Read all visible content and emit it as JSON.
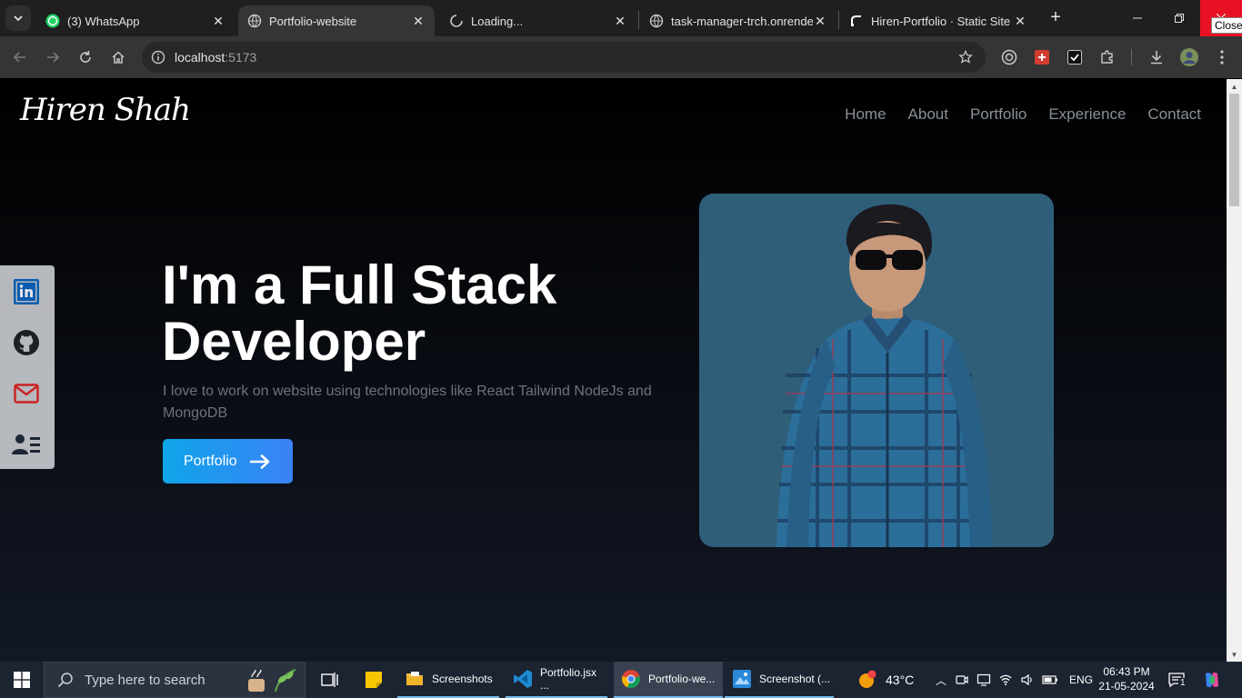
{
  "browser": {
    "tabs": [
      {
        "title": "(3) WhatsApp",
        "icon": "whatsapp-icon",
        "active": false
      },
      {
        "title": "Portfolio-website",
        "icon": "globe-icon",
        "active": true
      },
      {
        "title": "Loading...",
        "icon": "loading-spinner-icon",
        "active": false
      },
      {
        "title": "task-manager-trch.onrender",
        "icon": "globe-icon",
        "active": false
      },
      {
        "title": "Hiren-Portfolio · Static Site",
        "icon": "render-icon",
        "active": false
      }
    ],
    "close_tooltip": "Close",
    "url_host": "localhost",
    "url_port": ":5173"
  },
  "site": {
    "logo": "Hiren Shah",
    "nav": [
      "Home",
      "About",
      "Portfolio",
      "Experience",
      "Contact"
    ],
    "hero_title": "I'm a Full Stack Developer",
    "hero_subtitle": "I love to work on website using technologies like React Tailwind NodeJs and MongoDB",
    "cta_label": "Portfolio",
    "social": [
      "linkedin-icon",
      "github-icon",
      "mail-icon",
      "resume-icon"
    ],
    "photo_bg": "#2f5e79"
  },
  "taskbar": {
    "search_placeholder": "Type here to search",
    "apps": [
      {
        "label": "Screenshots",
        "icon": "folder-icon"
      },
      {
        "label": "Portfolio.jsx ...",
        "icon": "vscode-icon"
      },
      {
        "label": "Portfolio-we...",
        "icon": "chrome-icon"
      },
      {
        "label": "Screenshot (...",
        "icon": "photos-icon"
      }
    ],
    "weather": "43°C",
    "language": "ENG",
    "time": "06:43 PM",
    "date": "21-05-2024",
    "notification_count": "1"
  },
  "colors": {
    "accent_start": "#0ea5e9",
    "accent_end": "#3b82f6",
    "nav_text": "#8a8f98"
  }
}
